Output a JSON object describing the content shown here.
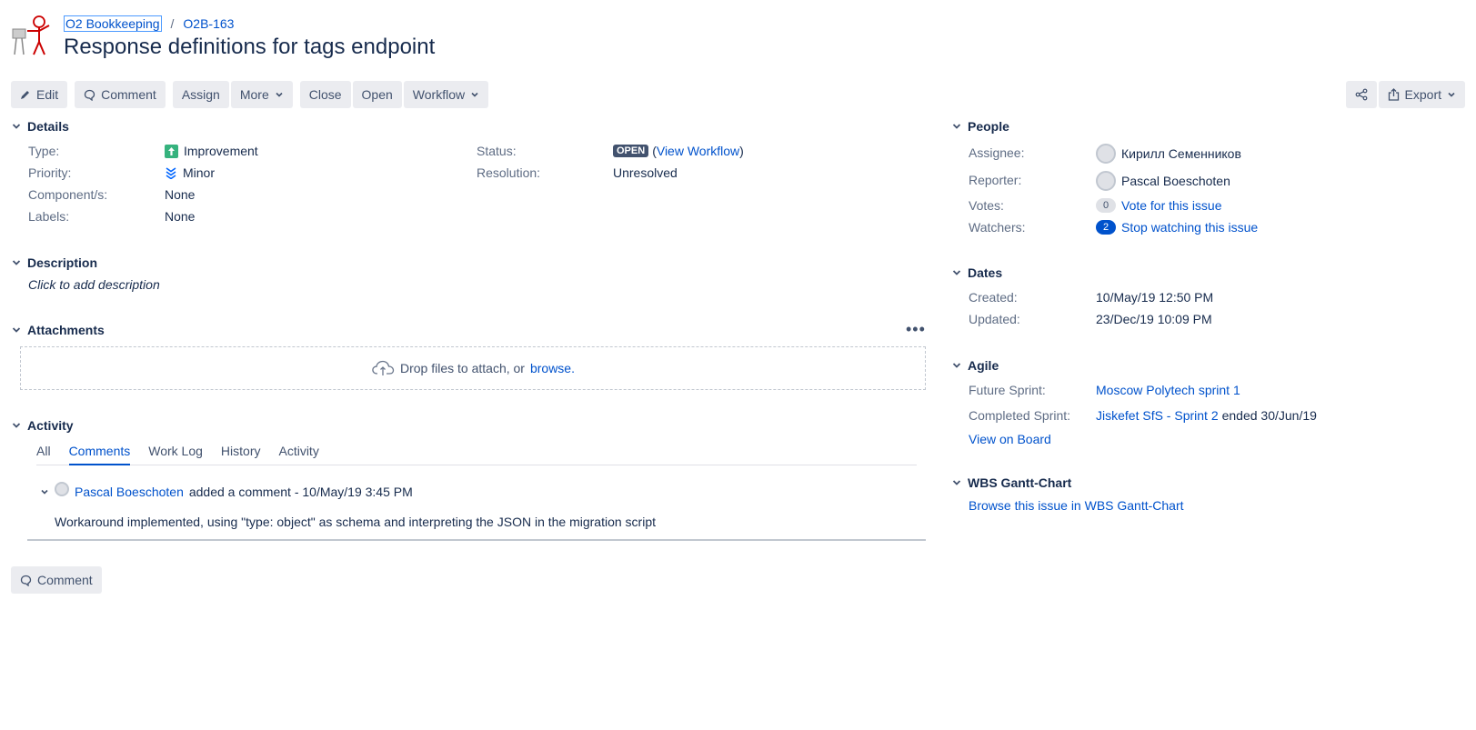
{
  "breadcrumb": {
    "project": "O2 Bookkeeping",
    "issue_key": "O2B-163"
  },
  "title": "Response definitions for tags endpoint",
  "toolbar": {
    "edit": "Edit",
    "comment": "Comment",
    "assign": "Assign",
    "more": "More",
    "close": "Close",
    "open": "Open",
    "workflow": "Workflow",
    "export": "Export"
  },
  "details": {
    "heading": "Details",
    "type_label": "Type:",
    "type_value": "Improvement",
    "priority_label": "Priority:",
    "priority_value": "Minor",
    "component_label": "Component/s:",
    "component_value": "None",
    "labels_label": "Labels:",
    "labels_value": "None",
    "status_label": "Status:",
    "status_value": "OPEN",
    "view_workflow": "View Workflow",
    "resolution_label": "Resolution:",
    "resolution_value": "Unresolved"
  },
  "description": {
    "heading": "Description",
    "placeholder": "Click to add description"
  },
  "attachments": {
    "heading": "Attachments",
    "drop_text": "Drop files to attach, or",
    "browse": "browse."
  },
  "activity": {
    "heading": "Activity",
    "tabs": [
      "All",
      "Comments",
      "Work Log",
      "History",
      "Activity"
    ],
    "active_tab": "Comments",
    "comment": {
      "author": "Pascal Boeschoten",
      "meta": "added a comment - 10/May/19 3:45 PM",
      "body": "Workaround implemented, using \"type: object\" as schema and interpreting the JSON in the migration script"
    },
    "comment_button": "Comment"
  },
  "people": {
    "heading": "People",
    "assignee_label": "Assignee:",
    "assignee": "Кирилл Семенников",
    "reporter_label": "Reporter:",
    "reporter": "Pascal Boeschoten",
    "votes_label": "Votes:",
    "votes_count": "0",
    "vote_link": "Vote for this issue",
    "watchers_label": "Watchers:",
    "watchers_count": "2",
    "watch_link": "Stop watching this issue"
  },
  "dates": {
    "heading": "Dates",
    "created_label": "Created:",
    "created": "10/May/19 12:50 PM",
    "updated_label": "Updated:",
    "updated": "23/Dec/19 10:09 PM"
  },
  "agile": {
    "heading": "Agile",
    "future_label": "Future Sprint:",
    "future_sprint": "Moscow Polytech sprint 1",
    "completed_label": "Completed Sprint:",
    "completed_sprint": "Jiskefet SfS - Sprint 2",
    "completed_suffix": "ended 30/Jun/19",
    "view_on_board": "View on Board"
  },
  "gantt": {
    "heading": "WBS Gantt-Chart",
    "link": "Browse this issue in WBS Gantt-Chart"
  },
  "colors": {
    "link": "#0052cc",
    "text": "#172b4d",
    "muted": "#5e6c84",
    "button_bg": "#ebecf0",
    "improvement": "#36b37e",
    "minor": "#0065ff"
  }
}
